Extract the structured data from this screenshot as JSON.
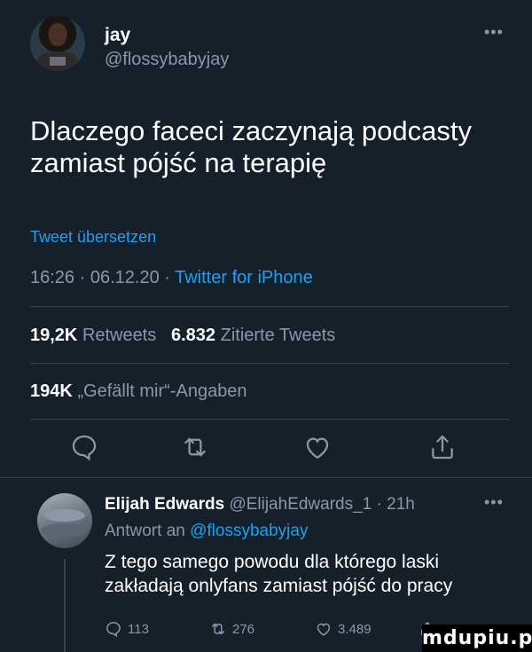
{
  "tweet": {
    "author_name": "jay",
    "author_handle": "@flossybabyjay",
    "more_icon": "more-dots-icon",
    "text": "Dlaczego faceci zaczynają podcasty zamiast pójść na terapię",
    "translate_label": "Tweet übersetzen",
    "time": "16:26",
    "date": "06.12.20",
    "separator": " · ",
    "source": "Twitter for iPhone",
    "retweets_count": "19,2K",
    "retweets_label": "Retweets",
    "quotes_count": "6.832",
    "quotes_label": "Zitierte Tweets",
    "likes_count": "194K",
    "likes_label": "„Gefällt mir“-Angaben",
    "actions": [
      "reply-icon",
      "retweet-icon",
      "like-icon",
      "share-icon"
    ]
  },
  "reply": {
    "author_name": "Elijah Edwards",
    "author_handle": "@ElijahEdwards_1",
    "time_ago": "21h",
    "separator": " · ",
    "reply_to_prefix": "Antwort an",
    "reply_to_handle": "@flossybabyjay",
    "text": "Z tego samego powodu dla którego laski zakładają onlyfans zamiast pójść do pracy",
    "replies": "113",
    "retweets": "276",
    "likes": "3.489"
  },
  "watermark": "mdupiu.pl",
  "colors": {
    "background": "#15202b",
    "accent": "#1da1f2",
    "muted": "#8899a6",
    "divider": "#38444d"
  }
}
